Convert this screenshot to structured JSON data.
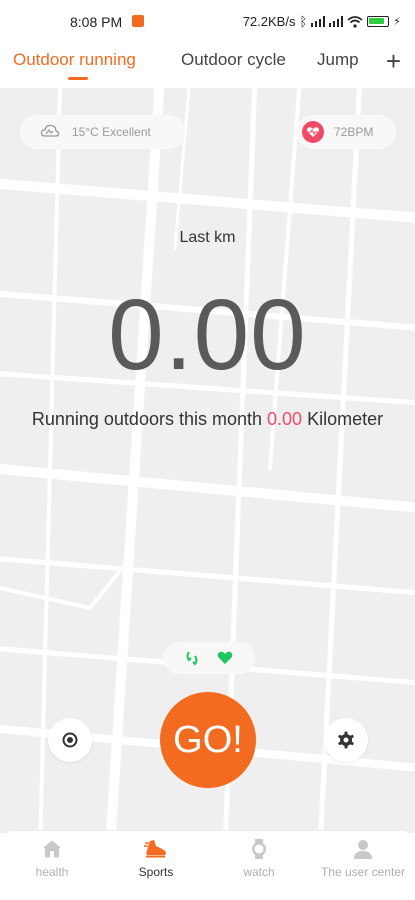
{
  "status_bar": {
    "time": "8:08 PM",
    "net_speed": "72.2KB/s"
  },
  "tabs": [
    {
      "label": "Outdoor running",
      "active": true
    },
    {
      "label": "Outdoor cycle",
      "active": false
    },
    {
      "label": "Jump",
      "active": false
    }
  ],
  "add_tab_label": "+",
  "weather": {
    "text": "15°C Excellent",
    "icon": "cloud-icon"
  },
  "heart_rate": {
    "text": "72BPM",
    "icon": "heart-rate-icon",
    "color": "#ef4b67"
  },
  "stats": {
    "label": "Last km",
    "value": "0.00",
    "month_prefix": "Running outdoors this month",
    "month_value": "0.00",
    "month_unit": "Kilometer"
  },
  "go_button": {
    "label": "GO!",
    "color": "#f26b21"
  },
  "bottom_nav": [
    {
      "label": "health",
      "icon": "home-icon",
      "active": false
    },
    {
      "label": "Sports",
      "icon": "running-shoe-icon",
      "active": true
    },
    {
      "label": "watch",
      "icon": "watch-icon",
      "active": false
    },
    {
      "label": "The user center",
      "icon": "user-icon",
      "active": false
    }
  ],
  "colors": {
    "accent": "#f26b21",
    "highlight": "#ef4b67",
    "indicator": "#22c55e"
  }
}
